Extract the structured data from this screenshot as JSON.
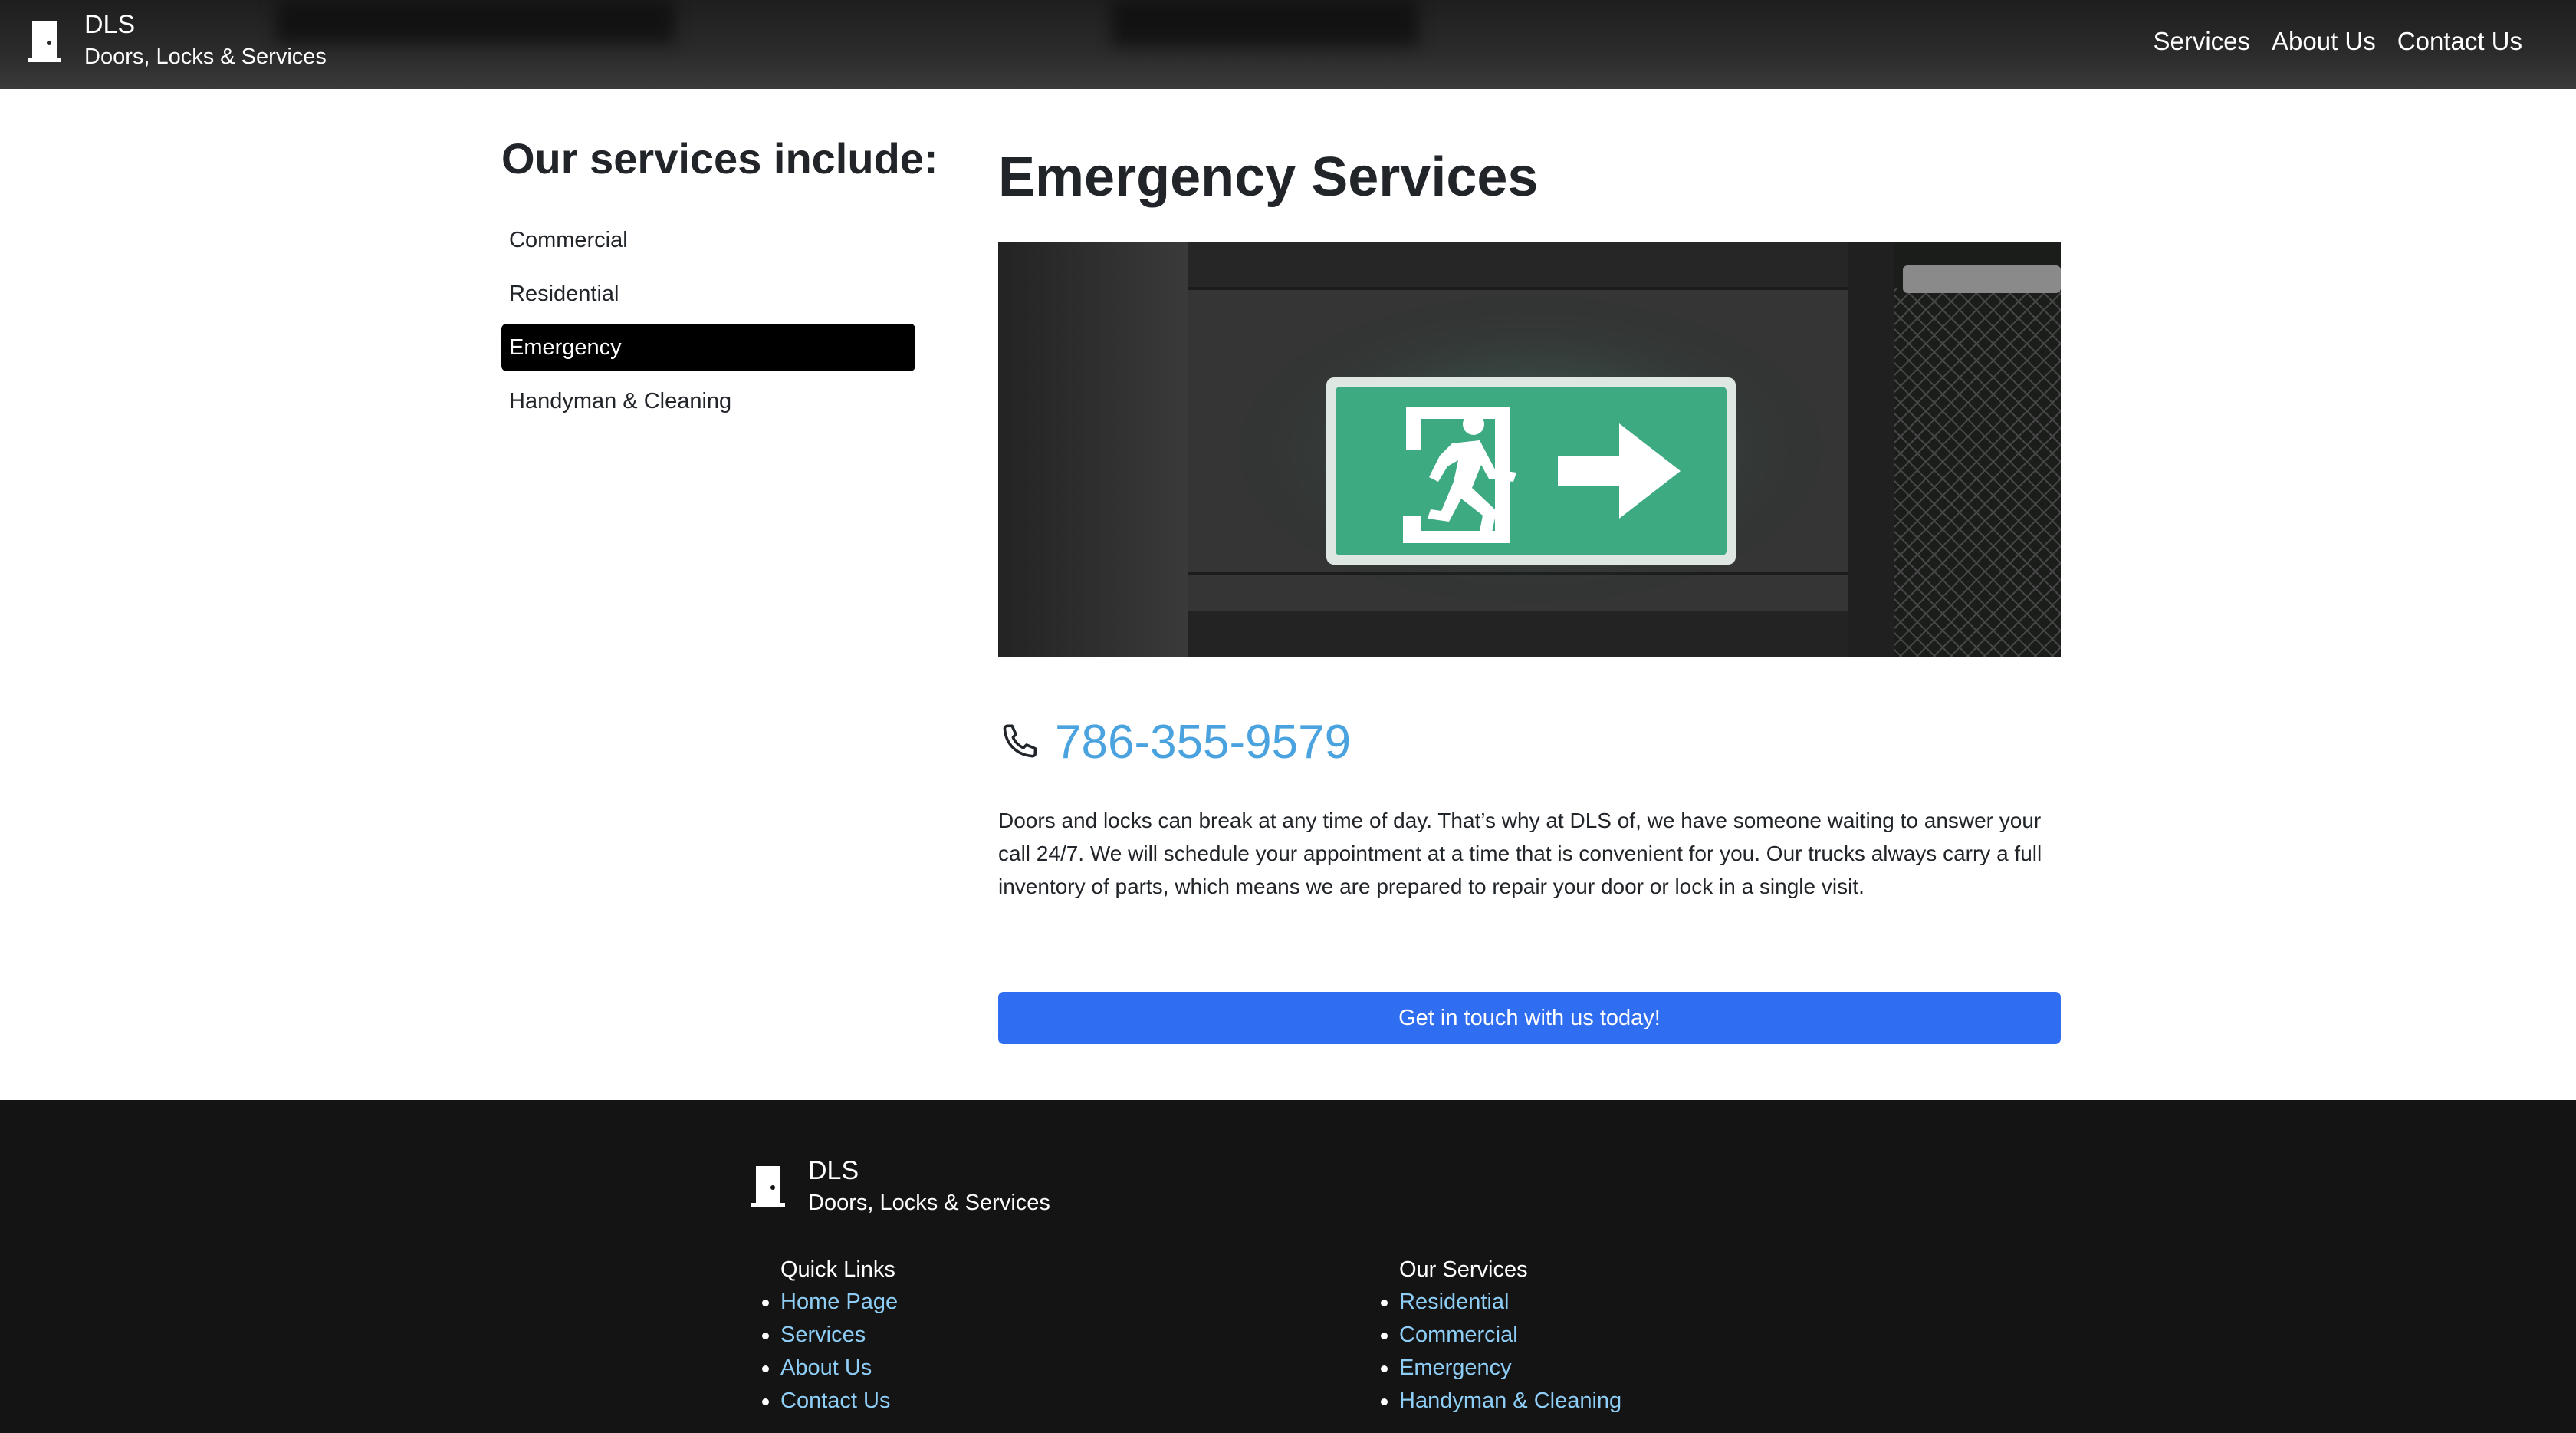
{
  "header": {
    "brand_title": "DLS",
    "brand_subtitle": "Doors, Locks & Services",
    "nav": [
      "Services",
      "About Us",
      "Contact Us"
    ]
  },
  "sidebar": {
    "title": "Our services include:",
    "items": [
      {
        "label": "Commercial",
        "active": false
      },
      {
        "label": "Residential",
        "active": false
      },
      {
        "label": "Emergency",
        "active": true
      },
      {
        "label": "Handyman & Cleaning",
        "active": false
      }
    ]
  },
  "main": {
    "title": "Emergency Services",
    "phone": "786-355-9579",
    "description": "Doors and locks can break at any time of day. That’s why at DLS of, we have someone waiting to answer your call 24/7. We will schedule your appointment at a time that is convenient for you. Our trucks always carry a full inventory of parts, which means we are prepared to repair your door or lock in a single visit.",
    "cta_label": "Get in touch with us today!"
  },
  "footer": {
    "brand_title": "DLS",
    "brand_subtitle": "Doors, Locks & Services",
    "quick_links_title": "Quick Links",
    "quick_links": [
      "Home Page",
      "Services",
      "About Us",
      "Contact Us"
    ],
    "services_title": "Our Services",
    "services": [
      "Residential",
      "Commercial",
      "Emergency",
      "Handyman & Cleaning"
    ]
  },
  "colors": {
    "header_bg": "#2b2b2b",
    "active_item_bg": "#000000",
    "phone_link": "#4aa3df",
    "cta_bg": "#2f6df1",
    "footer_bg": "#141414",
    "footer_link": "#8ecdf5",
    "exit_sign_green": "#3daa82"
  },
  "icons": {
    "logo": "door-icon",
    "phone": "phone-icon",
    "hero": "exit-sign-image"
  }
}
